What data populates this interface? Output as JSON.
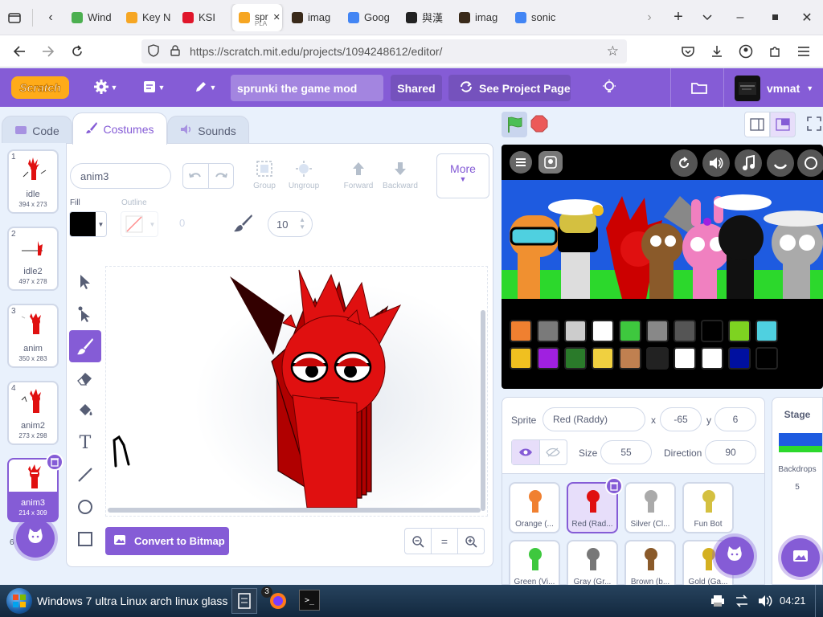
{
  "browser": {
    "tabs": [
      {
        "label": "Wind",
        "color": "#4caf50"
      },
      {
        "label": "Key N",
        "color": "#f6a623"
      },
      {
        "label": "KSI",
        "color": "#e0162b"
      },
      {
        "label": "spr",
        "sub": "PLA",
        "color": "#f6a623"
      },
      {
        "label": "imag",
        "color": "#3a2a1a"
      },
      {
        "label": "Goog",
        "color": "#4285f4"
      },
      {
        "label": "與漢",
        "color": "#222"
      },
      {
        "label": "imag",
        "color": "#3a2a1a"
      },
      {
        "label": "sonic",
        "color": "#4285f4"
      }
    ],
    "url": "https://scratch.mit.edu/projects/1094248612/editor/"
  },
  "menubar": {
    "logo": "Scratch",
    "project_title": "sprunki the game mod",
    "shared_label": "Shared",
    "see_project_label": "See Project Page",
    "username": "vmnat"
  },
  "editor_tabs": {
    "code": "Code",
    "costumes": "Costumes",
    "sounds": "Sounds"
  },
  "costumes": [
    {
      "num": "1",
      "name": "idle",
      "dim": "394 x 273"
    },
    {
      "num": "2",
      "name": "idle2",
      "dim": "497 x 278"
    },
    {
      "num": "3",
      "name": "anim",
      "dim": "350 x 283"
    },
    {
      "num": "4",
      "name": "anim2",
      "dim": "273 x 298"
    },
    {
      "num": "5",
      "name": "anim3",
      "dim": "214 x 309"
    }
  ],
  "costume_six": "6",
  "paint": {
    "costume_name": "anim3",
    "group": "Group",
    "ungroup": "Ungroup",
    "forward": "Forward",
    "backward": "Backward",
    "more": "More",
    "fill_label": "Fill",
    "outline_label": "Outline",
    "outline_value": "0",
    "brush_size": "10",
    "convert_label": "Convert to Bitmap",
    "fill_color": "#000000"
  },
  "sprite_info": {
    "sprite_label": "Sprite",
    "sprite_name": "Red (Raddy)",
    "x_label": "x",
    "x": "-65",
    "y_label": "y",
    "y": "6",
    "size_label": "Size",
    "size": "55",
    "direction_label": "Direction",
    "direction": "90"
  },
  "sprites": [
    {
      "name": "Orange (...",
      "color": "#f08030"
    },
    {
      "name": "Red (Rad...",
      "color": "#e01010"
    },
    {
      "name": "Silver (Cl...",
      "color": "#aaaaaa"
    },
    {
      "name": "Fun Bot",
      "color": "#d4c040"
    },
    {
      "name": "Green (Vi...",
      "color": "#3ec83e"
    },
    {
      "name": "Gray (Gr...",
      "color": "#777777"
    },
    {
      "name": "Brown (b...",
      "color": "#8a5a2a"
    },
    {
      "name": "Gold (Ga...",
      "color": "#d4b020"
    }
  ],
  "stage_panel": {
    "title": "Stage",
    "backdrops_label": "Backdrops",
    "backdrops_count": "5"
  },
  "stage_palette": [
    "#f08030",
    "#7a7a7a",
    "#cccccc",
    "#ffffff",
    "#3ec83e",
    "#888888",
    "#555555",
    "#000000",
    "#7ed321",
    "#4fd0e0",
    "#f0c020",
    "#a020e0",
    "#2a7a2a",
    "#f0d040",
    "#c08050",
    "#222222",
    "#ffffff",
    "#ffffff",
    "#0010a0",
    "#000000"
  ],
  "taskbar": {
    "start_label": "Windows 7 ultra Linux arch linux glass",
    "badge": "3",
    "clock": "04:21"
  },
  "colors": {
    "scratch_purple": "#855cd6",
    "accent_blue": "#4c97ff",
    "red_char": "#e01010"
  }
}
